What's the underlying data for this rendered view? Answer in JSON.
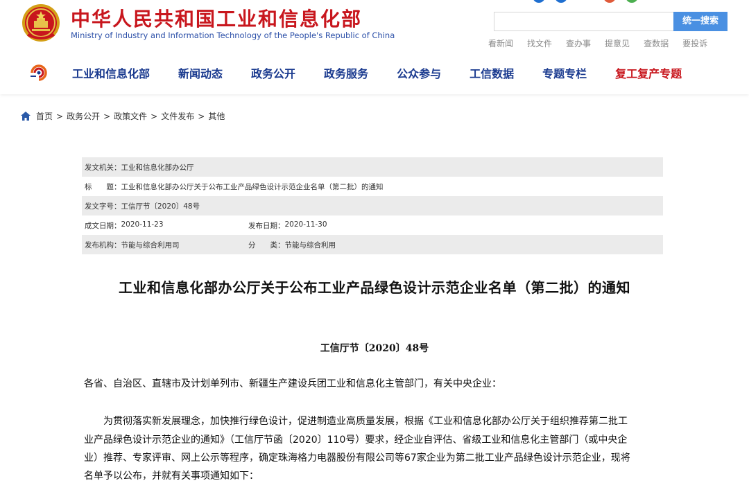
{
  "header": {
    "site_title": "中华人民共和国工业和信息化部",
    "site_subtitle": "Ministry of Industry and Information Technology of the People's Republic of China",
    "search_placeholder": "",
    "search_button": "统一搜索",
    "quick_links": [
      "看新闻",
      "找文件",
      "查办事",
      "提意见",
      "查数据",
      "要投诉"
    ],
    "top_icon_colors": [
      "#1f6fd0",
      "#1f6fd0",
      "#e05a3a",
      "#4caf50"
    ]
  },
  "nav": {
    "items": [
      "工业和信息化部",
      "新闻动态",
      "政务公开",
      "政务服务",
      "公众参与",
      "工信数据",
      "专题专栏"
    ],
    "special_item": "复工复产专题",
    "accent_color": "#1a3a8f",
    "special_color": "#c8161d"
  },
  "breadcrumb": {
    "items": [
      "首页",
      "政务公开",
      "政策文件",
      "文件发布",
      "其他"
    ],
    "separator": ">"
  },
  "meta": {
    "issuer_label": "发文机关：",
    "issuer_value": "工业和信息化部办公厅",
    "title_label": "标　　题：",
    "title_value": "工业和信息化部办公厅关于公布工业产品绿色设计示范企业名单（第二批）的通知",
    "docno_label": "发文字号：",
    "docno_value": "工信厅节〔2020〕48号",
    "created_label": "成文日期：",
    "created_value": "2020-11-23",
    "published_label": "发布日期：",
    "published_value": "2020-11-30",
    "org_label": "发布机构：",
    "org_value": "节能与综合利用司",
    "category_label": "分　　类：",
    "category_value": "节能与综合利用"
  },
  "article": {
    "title": "工业和信息化部办公厅关于公布工业产品绿色设计示范企业名单（第二批）的通知",
    "doc_number": "工信厅节〔2020〕48号",
    "salutation": "各省、自治区、直辖市及计划单列市、新疆生产建设兵团工业和信息化主管部门，有关中央企业：",
    "para_lines": [
      "　　为贯彻落实新发展理念，加快推行绿色设计，促进制造业高质量发展，根据《工业和信息化部办公厅关于组织推荐第二批工",
      "业产品绿色设计示范企业的通知》（工信厅节函〔2020〕110号）要求，经企业自评估、省级工业和信息化主管部门（或中央企",
      "业）推荐、专家评审、网上公示等程序，确定珠海格力电器股份有限公司等67家企业为第二批工业产品绿色设计示范企业，现将",
      "名单予以公布，并就有关事项通知如下："
    ]
  }
}
